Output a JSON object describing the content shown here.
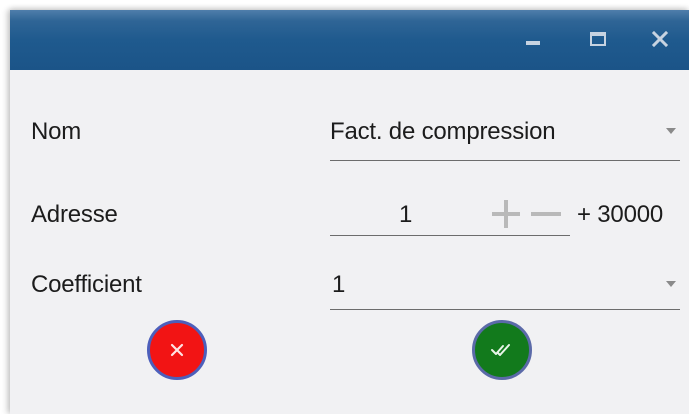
{
  "window": {
    "controls": [
      "minimize-icon",
      "maximize-icon",
      "close-icon"
    ]
  },
  "form": {
    "nom": {
      "label": "Nom",
      "value": "Fact. de compression"
    },
    "adresse": {
      "label": "Adresse",
      "value": "1",
      "suffix": "+ 30000"
    },
    "coefficient": {
      "label": "Coefficient",
      "value": "1"
    }
  },
  "actions": {
    "cancel": {
      "icon": "close-icon"
    },
    "ok": {
      "icon": "double-check-icon"
    }
  },
  "colors": {
    "titlebar": "#1f5a8e",
    "cancel": "#f21414",
    "ok": "#127a1c"
  }
}
